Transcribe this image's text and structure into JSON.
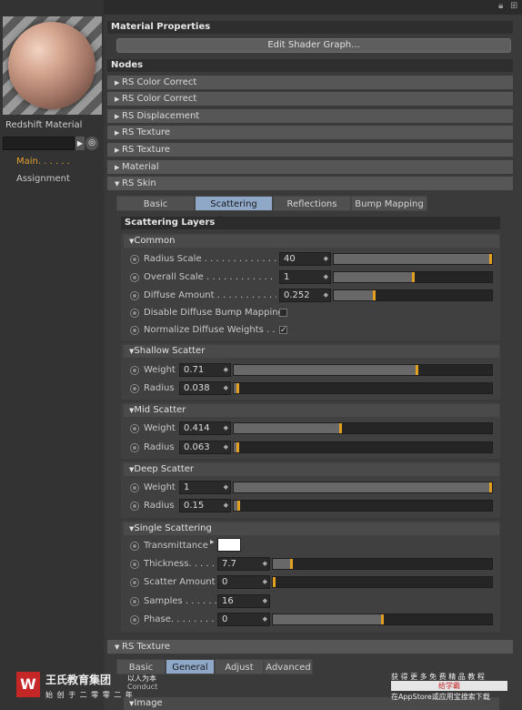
{
  "left_panel": {
    "material_name": "Redshift Material",
    "links": [
      "Main. . . . . .",
      "Assignment"
    ]
  },
  "material_properties": {
    "title": "Material Properties",
    "edit_button": "Edit Shader Graph..."
  },
  "nodes": {
    "title": "Nodes",
    "items": [
      "RS Color Correct",
      "RS Color Correct",
      "RS Displacement",
      "RS Texture",
      "RS Texture",
      "Material",
      "RS Skin"
    ]
  },
  "rs_skin": {
    "tabs": [
      "Basic",
      "Scattering Layers",
      "Reflections",
      "Bump Mapping"
    ],
    "active_tab": "Scattering Layers",
    "section_title": "Scattering Layers",
    "common": {
      "title": "Common",
      "radius_scale": {
        "label": "Radius Scale . . . . . . . . . . . . . .",
        "value": "40",
        "fill": 1.0
      },
      "overall_scale": {
        "label": "Overall Scale . . . . . . . . . . . . .",
        "value": "1",
        "fill": 0.5
      },
      "diffuse_amount": {
        "label": "Diffuse Amount . . . . . . . . . . . .",
        "value": "0.252",
        "fill": 0.25
      },
      "disable_bump": {
        "label": "Disable Diffuse Bump Mapping",
        "checked": false
      },
      "normalize": {
        "label": "Normalize Diffuse Weights . . .",
        "checked": true,
        "check_glyph": "✓"
      }
    },
    "shallow": {
      "title": "Shallow Scatter",
      "weight": {
        "label": "Weight",
        "value": "0.71",
        "fill": 0.71
      },
      "radius": {
        "label": "Radius",
        "value": "0.038",
        "fill": 0.01
      }
    },
    "mid": {
      "title": "Mid Scatter",
      "weight": {
        "label": "Weight",
        "value": "0.414",
        "fill": 0.414
      },
      "radius": {
        "label": "Radius",
        "value": "0.063",
        "fill": 0.01
      }
    },
    "deep": {
      "title": "Deep Scatter",
      "weight": {
        "label": "Weight",
        "value": "1",
        "fill": 1.0
      },
      "radius": {
        "label": "Radius",
        "value": "0.15",
        "fill": 0.015
      }
    },
    "single": {
      "title": "Single Scattering",
      "transmittance": {
        "label": "Transmittance",
        "color": "#ffffff"
      },
      "thickness": {
        "label": "Thickness. . . . . .",
        "value": "7.7",
        "fill": 0.08
      },
      "scatter_amount": {
        "label": "Scatter Amount",
        "value": "0",
        "fill": 0.0
      },
      "samples": {
        "label": "Samples . . . . . . .",
        "value": "16"
      },
      "phase": {
        "label": "Phase. . . . . . . . .",
        "value": "0",
        "fill": 0.5
      }
    }
  },
  "rs_texture_bottom": {
    "title": "RS Texture",
    "tabs": [
      "Basic",
      "General",
      "Adjust",
      "Advanced"
    ],
    "active_tab": "General",
    "sub": "Image"
  },
  "watermark": {
    "brand": "王氏教育集团",
    "slogan": "以人为本",
    "sub_slogan": "Conduct",
    "tagline": "始 创 于 二 零 零 二 年",
    "promo1": "获 得 更 多 免 费 精 品 教 程",
    "promo2": "给学霸",
    "promo3": "在AppStore或应用宝搜索下载"
  },
  "colors": {
    "accent": "#e3a020",
    "active_tab": "#8fa8c8",
    "link_active": "#e0a030"
  }
}
